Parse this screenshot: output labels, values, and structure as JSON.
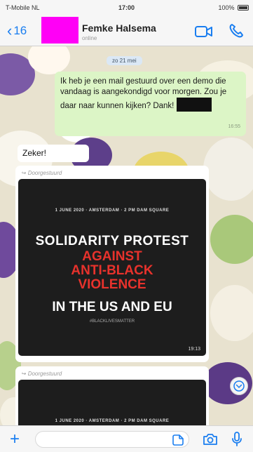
{
  "status_bar": {
    "carrier": "T-Mobile NL",
    "time": "17:00",
    "battery": "100%"
  },
  "header": {
    "back_count": "16",
    "contact_name": "Femke Halsema",
    "contact_status": "online"
  },
  "chat": {
    "date_label": "zo 21 mei",
    "outgoing_message": "Ik heb je een mail gestuurd over een demo die vandaag is aangekondigd voor morgen. Zou je daar naar kunnen kijken? Dank!",
    "outgoing_time": "16:55",
    "incoming_reply": "Zeker!",
    "forwarded_label": "Doorgestuurd",
    "poster": {
      "top_line": "1 JUNE 2020 · AMSTERDAM · 2 PM DAM SQUARE",
      "line1": "SOLIDARITY PROTEST",
      "line2a": "AGAINST",
      "line2b": "ANTI-BLACK",
      "line2c": "VIOLENCE",
      "line3": "IN THE US AND EU",
      "hashtag": "#BLACKLIVESMATTER",
      "time": "19:13"
    },
    "forwarded_label_2": "Doorgestuurd",
    "poster2_top_line": "1 JUNE 2020 · AMSTERDAM · 2 PM DAM SQUARE"
  },
  "input": {
    "placeholder": ""
  },
  "colors": {
    "accent": "#1a7ef0",
    "outgoing_bubble": "#dcf5c6",
    "redact_magenta": "#ff00f6",
    "poster_red": "#e8322c"
  }
}
